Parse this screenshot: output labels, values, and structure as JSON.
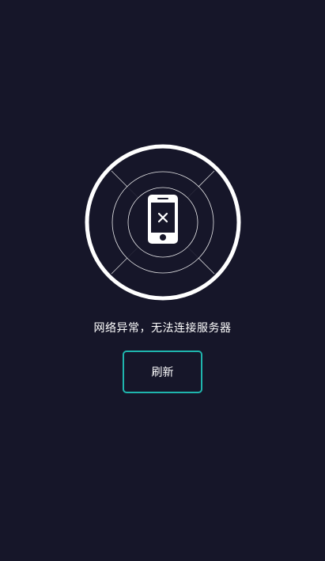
{
  "error": {
    "message": "网络异常，无法连接服务器",
    "icon": "phone-disconnected-icon"
  },
  "actions": {
    "refresh_label": "刷新"
  },
  "colors": {
    "background": "#161629",
    "accent_border": "#1fb5ad",
    "foreground": "#ffffff"
  }
}
